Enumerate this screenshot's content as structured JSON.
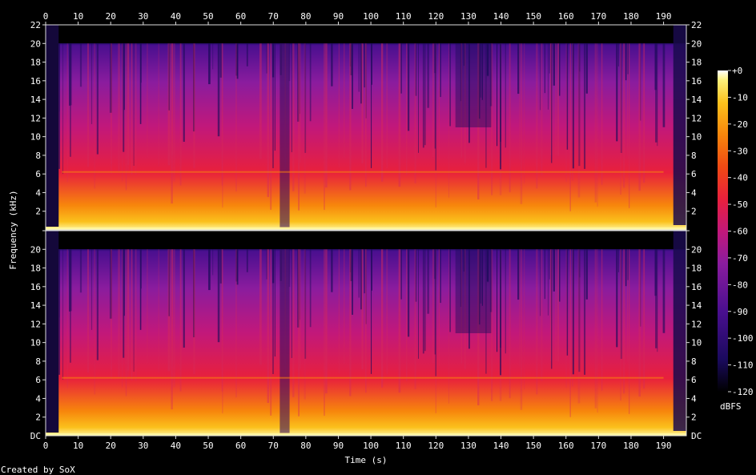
{
  "chart_data": {
    "type": "heatmap",
    "title": "",
    "xlabel": "Time (s)",
    "ylabel": "Frequency (kHz)",
    "xlim": [
      0,
      197
    ],
    "ylim": [
      0,
      22
    ],
    "x_ticks": [
      0,
      10,
      20,
      30,
      40,
      50,
      60,
      70,
      80,
      90,
      100,
      110,
      120,
      130,
      140,
      150,
      160,
      170,
      180,
      190
    ],
    "y_ticks": [
      2,
      4,
      6,
      8,
      10,
      12,
      14,
      16,
      18,
      20,
      22
    ],
    "y_tick_labels_top": [
      "2",
      "4",
      "6",
      "8",
      "10",
      "12",
      "14",
      "16",
      "18",
      "20",
      "22"
    ],
    "y_tick_labels_bottom": [
      "DC",
      "2",
      "4",
      "6",
      "8",
      "10",
      "12",
      "14",
      "16",
      "18",
      "20"
    ],
    "channels": 2,
    "colorbar": {
      "label": "dBFS",
      "range": [
        -120,
        0
      ],
      "ticks": [
        "+0",
        "-10",
        "-20",
        "-30",
        "-40",
        "-50",
        "-60",
        "-70",
        "-80",
        "-90",
        "-100",
        "-110",
        "-120"
      ],
      "colors": [
        "#000000",
        "#1a0a5e",
        "#4a0f8f",
        "#8a1c9e",
        "#c2187a",
        "#e8203c",
        "#f04a14",
        "#f7860c",
        "#fbc11c",
        "#fdf07a",
        "#ffffff"
      ]
    },
    "features": {
      "cutoff_khz": 20,
      "silent_start_s": 4,
      "dip_at_s": 73,
      "fade_end_s": 193
    }
  },
  "footer": {
    "credit": "Created by SoX"
  }
}
